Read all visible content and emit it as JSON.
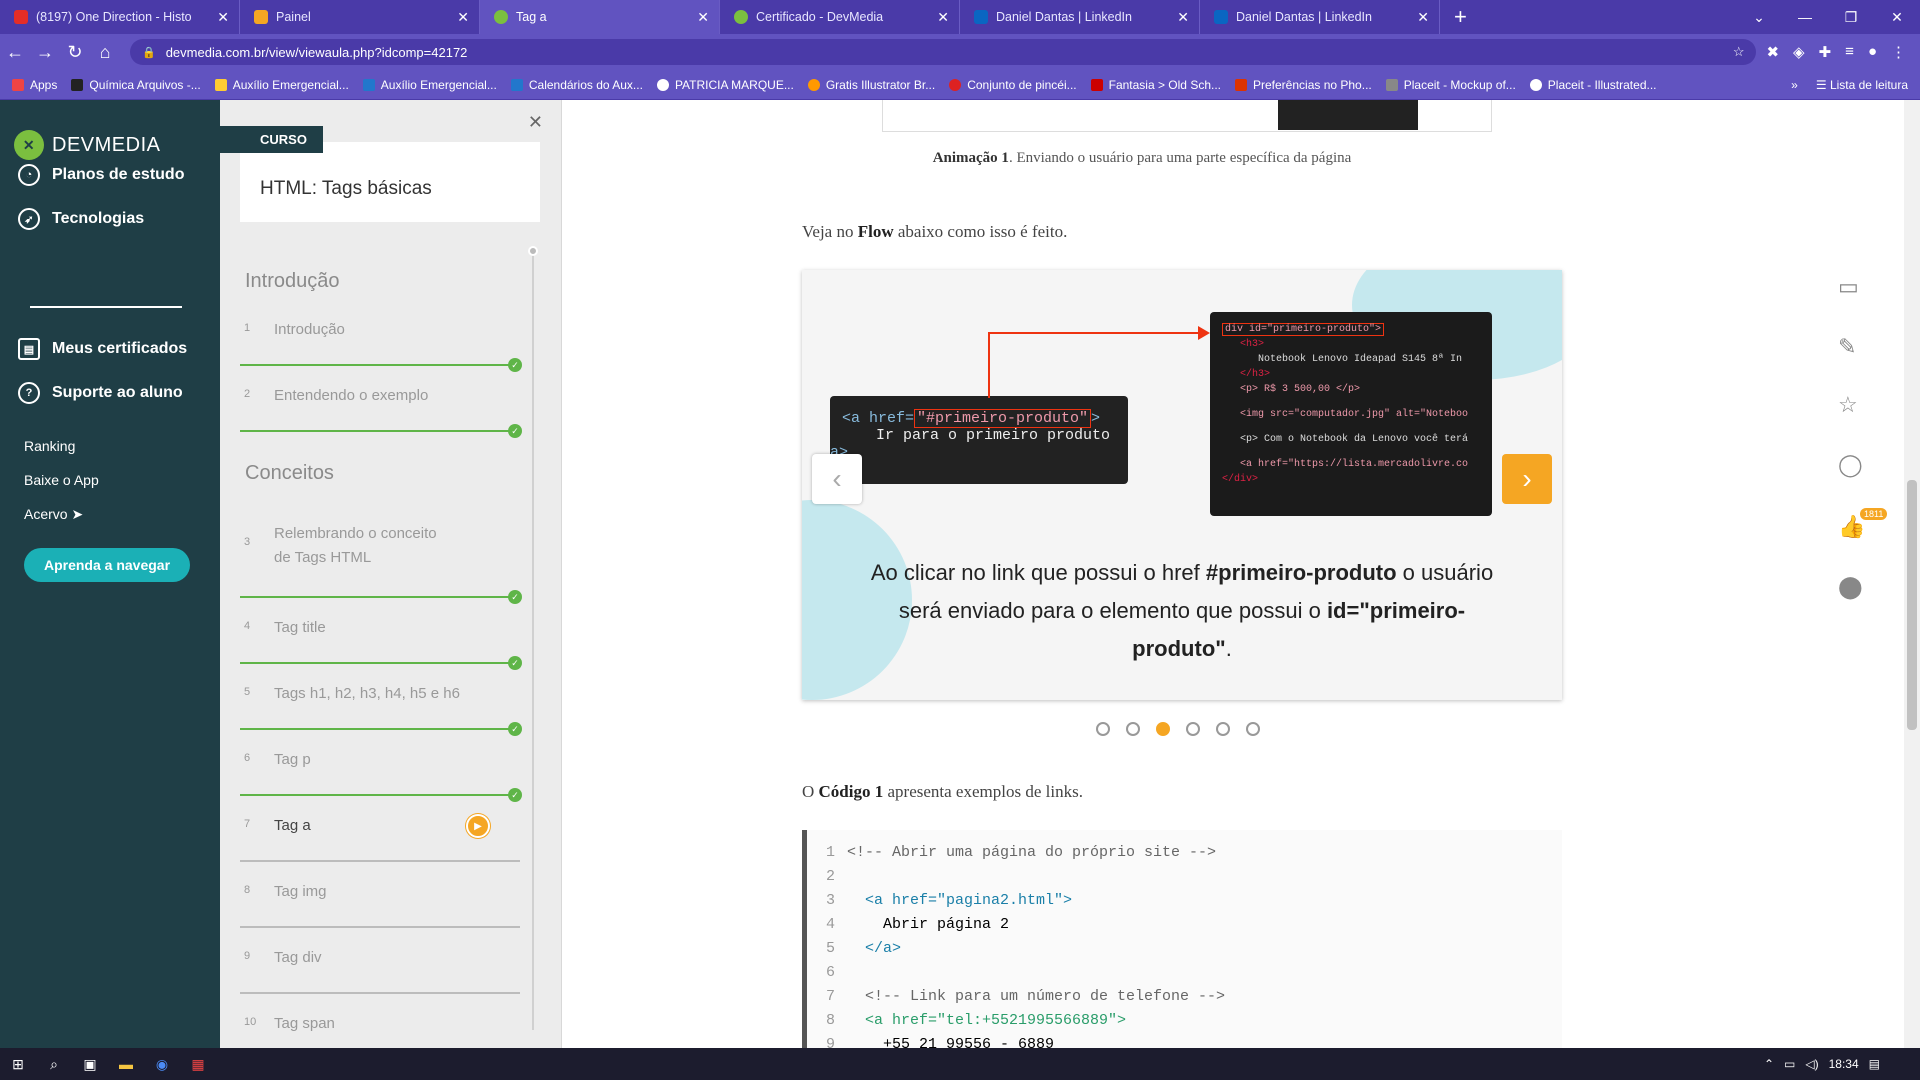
{
  "browser": {
    "tabs": [
      {
        "title": "(8197) One Direction - Histo",
        "color": "#e52d27"
      },
      {
        "title": "Painel",
        "color": "#f5a623"
      },
      {
        "title": "Tag a",
        "color": "#7bbf3f"
      },
      {
        "title": "Certificado - DevMedia",
        "color": "#7bbf3f"
      },
      {
        "title": "Daniel Dantas | LinkedIn",
        "color": "#0a66c2"
      },
      {
        "title": "Daniel Dantas | LinkedIn",
        "color": "#0a66c2"
      }
    ],
    "url": "devmedia.com.br/view/viewaula.php?idcomp=42172",
    "bookmarks": [
      "Apps",
      "Química Arquivos -...",
      "Auxílio Emergencial...",
      "Auxílio Emergencial...",
      "Calendários do Aux...",
      "PATRICIA MARQUE...",
      "Gratis Illustrator Br...",
      "Conjunto de pincéi...",
      "Fantasia > Old Sch...",
      "Preferências no Pho...",
      "Placeit - Mockup of...",
      "Placeit - Illustrated..."
    ],
    "reading_list": "Lista de leitura"
  },
  "sidebar": {
    "logo": "DEVMEDIA",
    "nav": [
      "Planos de estudo",
      "Tecnologias",
      "Meus certificados",
      "Suporte ao aluno"
    ],
    "links": [
      "Ranking",
      "Baixe o App",
      "Acervo ➤"
    ],
    "cta": "Aprenda a navegar"
  },
  "course": {
    "badge": "CURSO",
    "title": "HTML: Tags básicas",
    "sections": [
      "Introdução",
      "Conceitos"
    ],
    "lessons": [
      {
        "n": "1",
        "title": "Introdução"
      },
      {
        "n": "2",
        "title": "Entendendo o exemplo"
      },
      {
        "n": "3",
        "title": "Relembrando o conceito de Tags HTML"
      },
      {
        "n": "4",
        "title": "Tag title"
      },
      {
        "n": "5",
        "title": "Tags h1, h2, h3, h4, h5 e h6"
      },
      {
        "n": "6",
        "title": "Tag p"
      },
      {
        "n": "7",
        "title": "Tag a"
      },
      {
        "n": "8",
        "title": "Tag img"
      },
      {
        "n": "9",
        "title": "Tag div"
      },
      {
        "n": "10",
        "title": "Tag span"
      }
    ]
  },
  "content": {
    "caption_bold": "Animação 1",
    "caption_rest": ". Enviando o usuário para uma parte específica da página",
    "flow_pre": "Veja no ",
    "flow_bold": "Flow",
    "flow_post": " abaixo como isso é feito.",
    "slide": {
      "code1_line1_a": "<a href=",
      "code1_line1_b": "\"#primeiro-produto\"",
      "code1_line1_c": ">",
      "code1_line2": "Ir para o primeiro produto",
      "code1_line3": "a>",
      "code2": [
        "div id=\"primeiro-produto\">",
        "<h3>",
        "Notebook Lenovo Ideapad S145 8ª In",
        "</h3>",
        "<p> R$ 3 500,00 </p>",
        "<img src=\"computador.jpg\" alt=\"Noteboo",
        "<p> Com o Notebook da Lenovo você terá",
        "<a href=\"https://lista.mercadolivre.co",
        "</div>"
      ],
      "text_1": "Ao clicar no link que possui o href ",
      "text_bold1": "#primeiro-produto",
      "text_2": " o usuário será enviado para o elemento que possui o ",
      "text_bold2": "id=\"primeiro-produto\"",
      "text_3": "."
    },
    "dots_active": 3,
    "code_pre": "O ",
    "code_bold": "Código 1",
    "code_post": " apresenta exemplos de links.",
    "code": [
      {
        "n": "1",
        "t": "<!-- Abrir uma página do próprio site -->"
      },
      {
        "n": "2",
        "t": ""
      },
      {
        "n": "3",
        "t": "  <a href=\"pagina2.html\">"
      },
      {
        "n": "4",
        "t": "    Abrir página 2"
      },
      {
        "n": "5",
        "t": "  </a>"
      },
      {
        "n": "6",
        "t": ""
      },
      {
        "n": "7",
        "t": "  <!-- Link para um número de telefone -->"
      },
      {
        "n": "8",
        "t": "  <a href=\"tel:+5521995566889\">"
      },
      {
        "n": "9",
        "t": "    +55 21 99556 - 6889"
      }
    ]
  },
  "right_tools": {
    "likes": "1811"
  },
  "taskbar": {
    "time": "18:34"
  }
}
